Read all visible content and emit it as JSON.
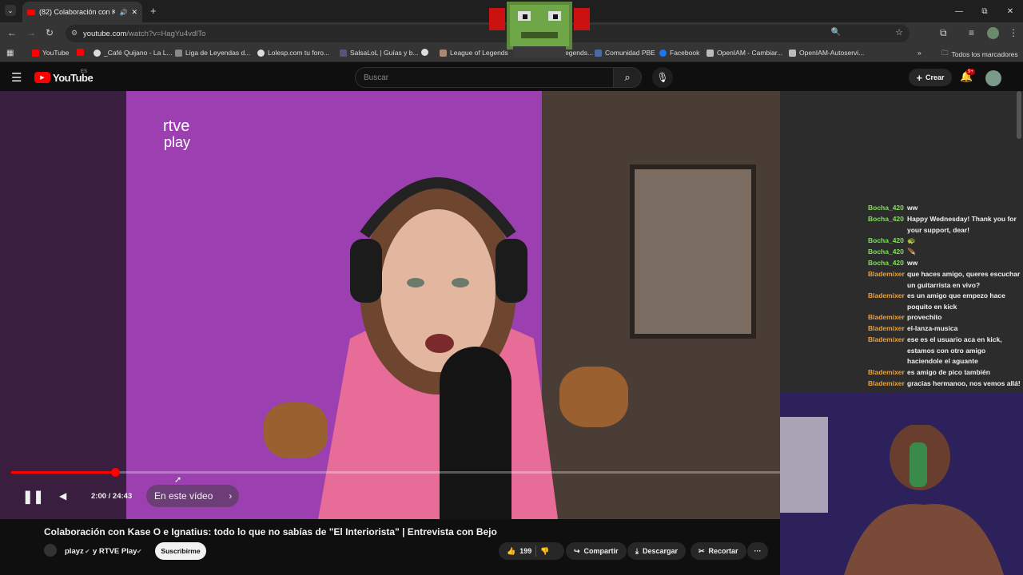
{
  "browser": {
    "tab_title": "(82) Colaboración con Kase",
    "new_tab": "+",
    "url_host": "youtube.com",
    "url_path": "/watch?v=HagYu4vdlTo",
    "window": {
      "minimize": "—",
      "restore": "⧉",
      "close": "✕"
    }
  },
  "bookmarks": {
    "items": [
      "YouTube",
      "_Café Quijano - La L...",
      "Liga de Leyendas d...",
      "Lolesp.com tu foro...",
      "SalsaLoL | Guías y b...",
      "League of Legends",
      "...egends...",
      "Comunidad PBE",
      "Facebook",
      "OpenIAM - Cambiar...",
      "OpenIAM-Autoservi..."
    ],
    "all_label": "Todos los marcadores"
  },
  "youtube": {
    "logo": "YouTube",
    "logo_region": "ES",
    "search_placeholder": "Buscar",
    "create_label": "Crear",
    "notif_count": "9+"
  },
  "video": {
    "channel_watermark_1": "rtve",
    "channel_watermark_2": "play",
    "time": "2:00 / 24:43",
    "chapters_label": "En este vídeo",
    "progress_fraction": 0.1349
  },
  "chat": [
    {
      "user": "Bocha_420",
      "msg": "ᴡᴡ",
      "color": "#7fe057"
    },
    {
      "user": "Bocha_420",
      "msg": "Happy Wednesday! Thank you for your support, dear!",
      "color": "#7fe057"
    },
    {
      "user": "Bocha_420",
      "msg": "🐢",
      "color": "#7fe057"
    },
    {
      "user": "Bocha_420",
      "msg": "🪶",
      "color": "#7fe057"
    },
    {
      "user": "Bocha_420",
      "msg": "ᴡᴡ",
      "color": "#7fe057"
    },
    {
      "user": "Blademixer",
      "msg": "que haces amigo, queres escuchar un guitarrista en vivo?",
      "color": "#f0a030"
    },
    {
      "user": "Blademixer",
      "msg": "es un amigo que empezo hace poquito en kick",
      "color": "#f0a030"
    },
    {
      "user": "Blademixer",
      "msg": "provechito",
      "color": "#f0a030"
    },
    {
      "user": "Blademixer",
      "msg": "el-lanza-musica",
      "color": "#f0a030"
    },
    {
      "user": "Blademixer",
      "msg": "ese es el usuario aca en kick, estamos con otro amigo haciendole el aguante",
      "color": "#f0a030"
    },
    {
      "user": "Blademixer",
      "msg": "es amigo de pico también",
      "color": "#f0a030"
    },
    {
      "user": "Blademixer",
      "msg": "gracias hermanoo, nos vemos allá!",
      "color": "#f0a030"
    }
  ],
  "details": {
    "title": "Colaboración con Kase O e Ignatius: todo lo que no sabías de \"El Interiorista\" | Entrevista con Bejo",
    "channel": "playz",
    "collab": "y RTVE Play",
    "subscribe": "Suscribirme",
    "likes": "199",
    "share": "Compartir",
    "download": "Descargar",
    "clip": "Recortar",
    "more": "···"
  }
}
